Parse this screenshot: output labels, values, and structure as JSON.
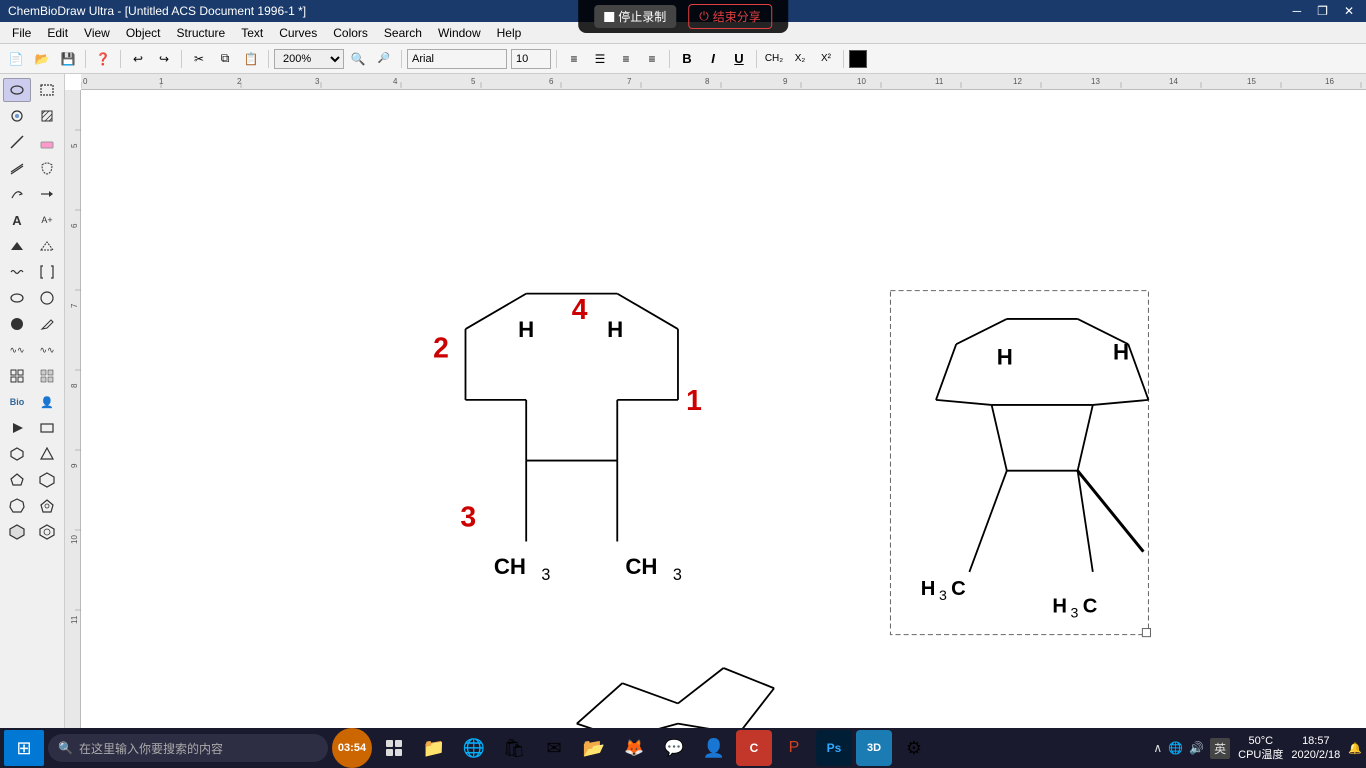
{
  "titlebar": {
    "title": "ChemBioDraw Ultra - [Untitled ACS Document 1996-1 *]",
    "minimize": "─",
    "maximize": "□",
    "close": "✕",
    "restore": "❐"
  },
  "recording": {
    "stop_label": "停止录制",
    "end_label": "结束分享"
  },
  "menubar": {
    "items": [
      "File",
      "Edit",
      "View",
      "Object",
      "Structure",
      "Text",
      "Curves",
      "Colors",
      "Search",
      "Window",
      "Help"
    ]
  },
  "toolbar": {
    "zoom_value": "200%",
    "buttons": [
      "new",
      "open",
      "save",
      "help",
      "undo",
      "redo",
      "cut",
      "copy",
      "paste"
    ]
  },
  "left_toolbar": {
    "tools": [
      "select-lasso",
      "select-rect",
      "magic-wand",
      "transform",
      "bond-straight",
      "eraser",
      "bond-multi",
      "lasso-frag",
      "arrows",
      "arrow-right",
      "text",
      "atom-label",
      "bond-up",
      "bond-down",
      "bond-wavy",
      "bracket",
      "circle",
      "ring",
      "filled-circle",
      "pen",
      "bond-any",
      "bond-zero",
      "chain",
      "chain-branch",
      "grid",
      "grid-dots",
      "bio",
      "person",
      "play",
      "rect-shape",
      "hex-ring",
      "ring-3",
      "ring-5",
      "ring-6",
      "ring-7",
      "ring-pent",
      "ring-hex-fill",
      "ring-hex"
    ]
  },
  "canvas": {
    "zoom": "200%",
    "rulers": {
      "top_marks": [
        "0",
        "1",
        "2",
        "3",
        "4",
        "5",
        "6",
        "7",
        "8",
        "9",
        "10",
        "11",
        "12",
        "13",
        "14",
        "15",
        "16"
      ],
      "left_marks": [
        "5",
        "6",
        "7",
        "8",
        "9",
        "10",
        "11"
      ]
    }
  },
  "structures": {
    "left": {
      "label_2": "2",
      "label_4": "4",
      "label_1": "1",
      "label_3": "3",
      "label_H1": "H",
      "label_H2": "H",
      "label_CH3_1": "CH",
      "label_CH3_2": "CH",
      "sub3_1": "3",
      "sub3_2": "3"
    },
    "right": {
      "label_H1": "H",
      "label_H2": "H",
      "label_H3C_1": "H",
      "label_H3C_2": "H",
      "sub3_1": "3",
      "sub3_2": "3",
      "C1": "C",
      "C2": "C"
    },
    "bottom": {
      "desc": "cyclohexane chair"
    }
  },
  "statusbar": {
    "text": ""
  },
  "taskbar": {
    "search_placeholder": "在这里输入你要搜索的内容",
    "time": "18:57",
    "date": "2020/2/18",
    "cpu_label": "50°C",
    "cpu_sub": "CPU温度",
    "lang": "英",
    "icons": [
      "task-view",
      "file-explorer",
      "edge",
      "store",
      "mail",
      "file-mgr",
      "firefox",
      "wechat",
      "avatar",
      "chemdraw",
      "ppt",
      "photoshop",
      "3ds",
      "settings"
    ]
  }
}
